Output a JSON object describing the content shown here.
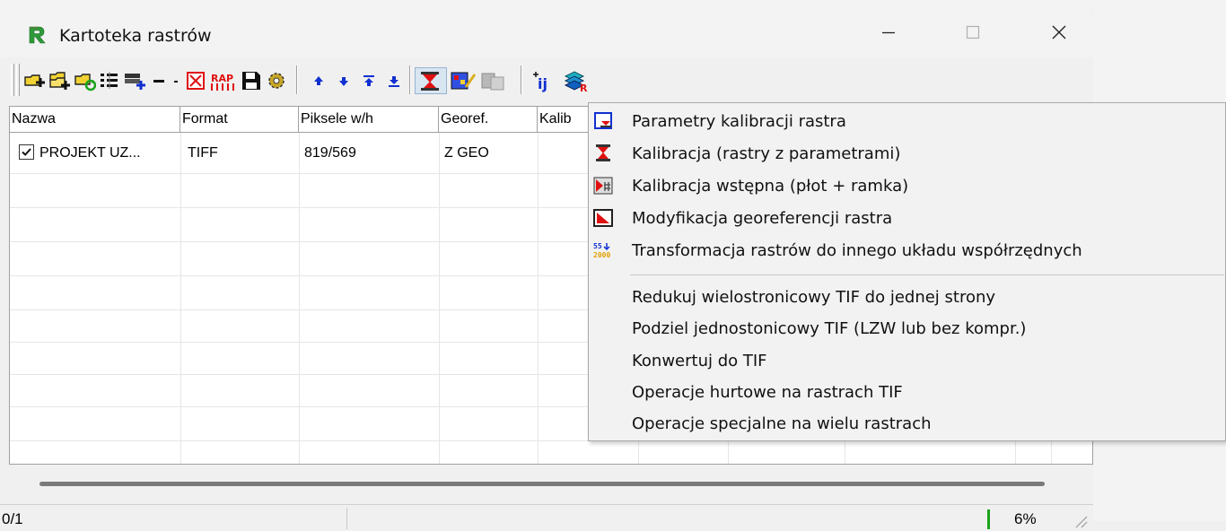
{
  "window": {
    "title": "Kartoteka rastrów"
  },
  "toolbar": {
    "buttons": [
      "add-raster-icon",
      "add-rasters-folder-icon",
      "refresh-raster-icon",
      "raster-properties-icon",
      "add-layer-icon",
      "remove-icon",
      "dropdown-arrow-icon",
      "delete-raster-icon",
      "rap-icon",
      "save-icon",
      "settings-gear-icon",
      "move-up-icon",
      "move-down-icon",
      "move-top-icon",
      "move-bottom-icon",
      "calibration-menu-icon",
      "edit-raster-icon",
      "copy-raster-icon",
      "ij-icon",
      "raster-layers-icon"
    ]
  },
  "table": {
    "columns": [
      "Nazwa",
      "Format",
      "Piksele w/h",
      "Georef.",
      "Kalib"
    ],
    "rows": [
      {
        "checked": true,
        "name": "PROJEKT UZ...",
        "format": "TIFF",
        "pixels": "819/569",
        "georef": "Z GEO"
      }
    ]
  },
  "status": {
    "count": "0/1",
    "percent": "6%"
  },
  "menu": {
    "items": [
      {
        "label": "Parametry kalibracji rastra",
        "icon": "calibration-params-icon"
      },
      {
        "label": "Kalibracja (rastry z parametrami)",
        "icon": "calibration-icon"
      },
      {
        "label": "Kalibracja wstępna (płot + ramka)",
        "icon": "pre-calibration-icon"
      },
      {
        "label": "Modyfikacja georeferencji rastra",
        "icon": "georef-modify-icon"
      },
      {
        "label": "Transformacja rastrów do innego układu współrzędnych",
        "icon": "transform-icon"
      }
    ],
    "items2": [
      {
        "label": "Redukuj wielostronicowy TIF do jednej strony"
      },
      {
        "label": "Podziel jednostonicowy TIF (LZW lub bez kompr.)"
      },
      {
        "label": "Konwertuj do TIF"
      },
      {
        "label": "Operacje hurtowe na rastrach TIF"
      },
      {
        "label": "Operacje specjalne na wielu rastrach"
      }
    ]
  },
  "colors": {
    "accent_red": "#e01010",
    "accent_blue": "#1030d0",
    "progress_green": "#1aa31a"
  }
}
